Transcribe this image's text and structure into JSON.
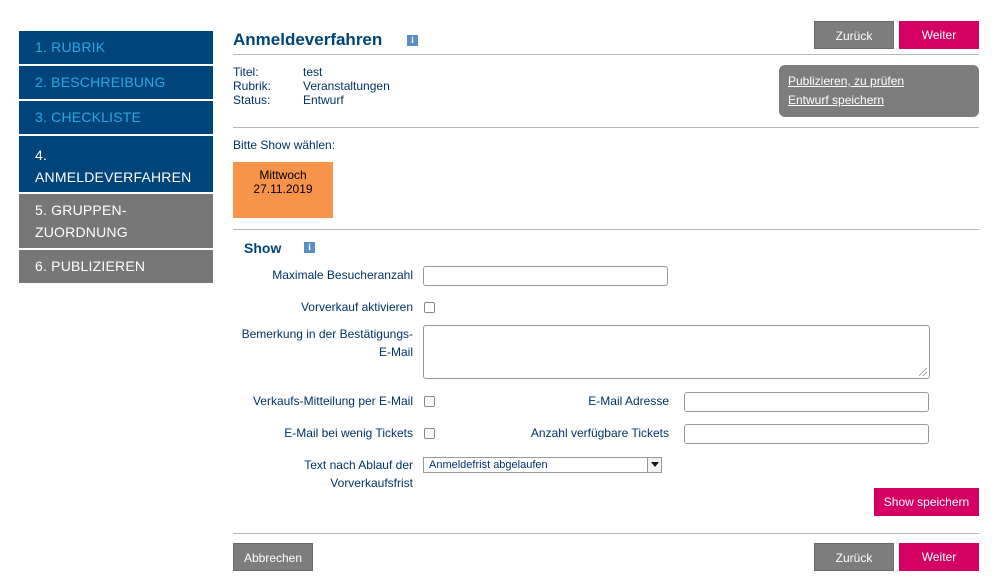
{
  "sidebar": {
    "items": [
      {
        "label": "1. RUBRIK"
      },
      {
        "label": "2. BESCHREIBUNG"
      },
      {
        "label": "3. CHECKLISTE"
      },
      {
        "label_line1": "4.",
        "label_line2": "ANMELDEVERFAHREN"
      },
      {
        "label_line1": "5. GRUPPEN-",
        "label_line2": "ZUORDNUNG"
      },
      {
        "label": "6. PUBLIZIEREN"
      }
    ]
  },
  "header": {
    "title": "Anmeldeverfahren",
    "info": "i",
    "back_label": "Zurück",
    "next_label": "Weiter"
  },
  "meta": {
    "title_label": "Titel:",
    "title_value": "test",
    "category_label": "Rubrik:",
    "category_value": "Veranstaltungen",
    "status_label": "Status:",
    "status_value": "Entwurf"
  },
  "actions": {
    "publish_link": "Publizieren, zu prüfen",
    "save_draft_link": "Entwurf speichern"
  },
  "show_select": {
    "prompt": "Bitte Show wählen:",
    "tile_day": "Mittwoch",
    "tile_date": "27.11.2019",
    "tile_color": "#f7944a"
  },
  "show_form": {
    "heading": "Show",
    "info": "i",
    "max_visitors_label": "Maximale Besucheranzahl",
    "max_visitors_value": "",
    "presale_label": "Vorverkauf aktivieren",
    "remark_label_line1": "Bemerkung in der Bestätigungs-",
    "remark_label_line2": "E-Mail",
    "remark_value": "",
    "sales_notify_label": "Verkaufs-Mitteilung per E-Mail",
    "email_label": "E-Mail Adresse",
    "email_value": "",
    "low_tickets_label": "E-Mail bei wenig Tickets",
    "ticket_count_label": "Anzahl verfügbare Tickets",
    "ticket_count_value": "",
    "expiry_text_label_line1": "Text nach Ablauf der",
    "expiry_text_label_line2": "Vorverkaufsfrist",
    "expiry_text_selected": "Anmeldefrist abgelaufen",
    "save_show_label": "Show speichern"
  },
  "footer": {
    "cancel_label": "Abbrechen",
    "back_label": "Zurück",
    "next_label": "Weiter"
  },
  "colors": {
    "primary_blue": "#00447c",
    "accent_pink": "#d50063",
    "grey": "#7d7d7d",
    "link_cyan": "#2ea7e0"
  }
}
